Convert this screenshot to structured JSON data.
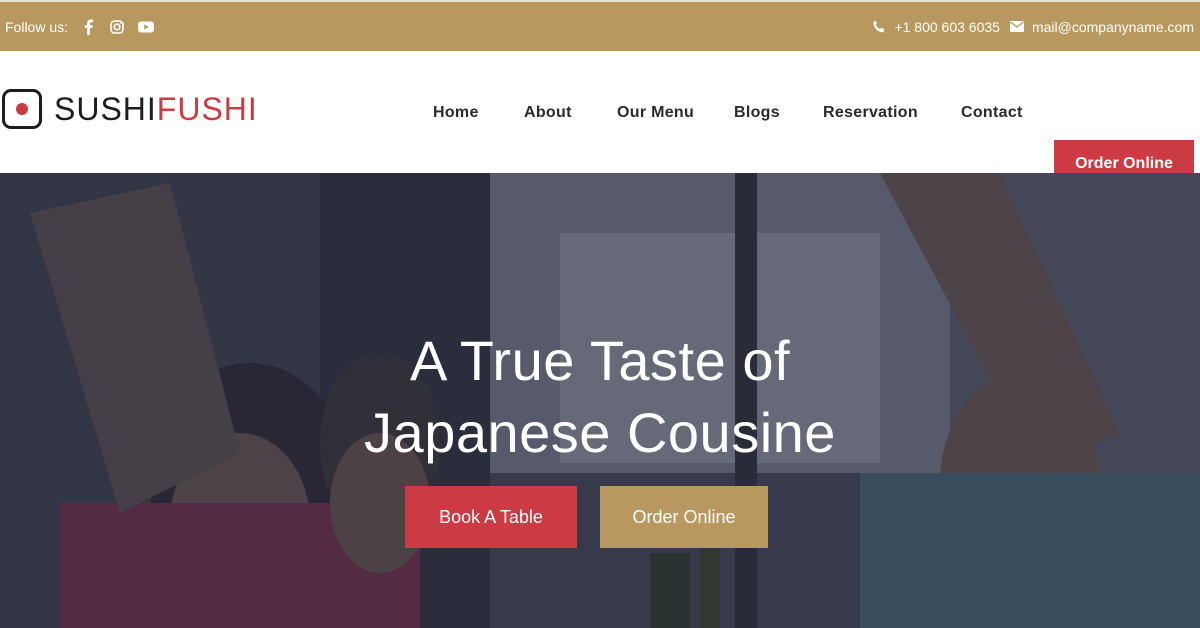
{
  "topbar": {
    "follow_label": "Follow us:",
    "social_icons": [
      "facebook-icon",
      "instagram-icon",
      "youtube-icon"
    ],
    "phone": "+1 800 603 6035",
    "email": "mail@companyname.com",
    "background": "#b8985e"
  },
  "logo": {
    "part1": "SUSHI",
    "part2": "FUSHI",
    "accent": "#cc3a43"
  },
  "nav": {
    "items": [
      "Home",
      "About",
      "Our Menu",
      "Blogs",
      "Reservation",
      "Contact"
    ],
    "order_label": "Order Online"
  },
  "hero": {
    "title_line1": "A True Taste of",
    "title_line2": "Japanese Cousine",
    "book_label": "Book A Table",
    "order_label": "Order Online",
    "book_color": "#cc3a43",
    "order_color": "#b8985e"
  }
}
